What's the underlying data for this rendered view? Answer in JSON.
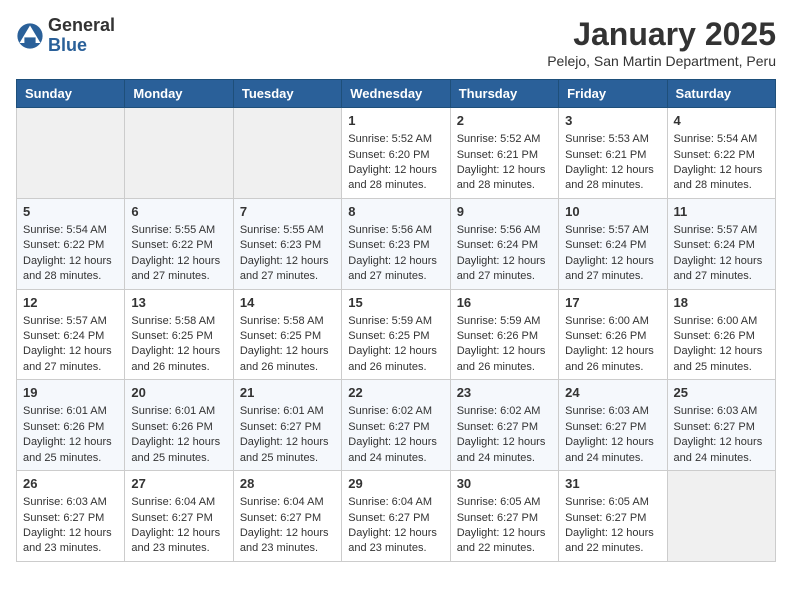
{
  "header": {
    "logo_general": "General",
    "logo_blue": "Blue",
    "month_title": "January 2025",
    "location": "Pelejo, San Martin Department, Peru"
  },
  "weekdays": [
    "Sunday",
    "Monday",
    "Tuesday",
    "Wednesday",
    "Thursday",
    "Friday",
    "Saturday"
  ],
  "weeks": [
    [
      {
        "day": "",
        "sunrise": "",
        "sunset": "",
        "daylight": ""
      },
      {
        "day": "",
        "sunrise": "",
        "sunset": "",
        "daylight": ""
      },
      {
        "day": "",
        "sunrise": "",
        "sunset": "",
        "daylight": ""
      },
      {
        "day": "1",
        "sunrise": "Sunrise: 5:52 AM",
        "sunset": "Sunset: 6:20 PM",
        "daylight": "Daylight: 12 hours and 28 minutes."
      },
      {
        "day": "2",
        "sunrise": "Sunrise: 5:52 AM",
        "sunset": "Sunset: 6:21 PM",
        "daylight": "Daylight: 12 hours and 28 minutes."
      },
      {
        "day": "3",
        "sunrise": "Sunrise: 5:53 AM",
        "sunset": "Sunset: 6:21 PM",
        "daylight": "Daylight: 12 hours and 28 minutes."
      },
      {
        "day": "4",
        "sunrise": "Sunrise: 5:54 AM",
        "sunset": "Sunset: 6:22 PM",
        "daylight": "Daylight: 12 hours and 28 minutes."
      }
    ],
    [
      {
        "day": "5",
        "sunrise": "Sunrise: 5:54 AM",
        "sunset": "Sunset: 6:22 PM",
        "daylight": "Daylight: 12 hours and 28 minutes."
      },
      {
        "day": "6",
        "sunrise": "Sunrise: 5:55 AM",
        "sunset": "Sunset: 6:22 PM",
        "daylight": "Daylight: 12 hours and 27 minutes."
      },
      {
        "day": "7",
        "sunrise": "Sunrise: 5:55 AM",
        "sunset": "Sunset: 6:23 PM",
        "daylight": "Daylight: 12 hours and 27 minutes."
      },
      {
        "day": "8",
        "sunrise": "Sunrise: 5:56 AM",
        "sunset": "Sunset: 6:23 PM",
        "daylight": "Daylight: 12 hours and 27 minutes."
      },
      {
        "day": "9",
        "sunrise": "Sunrise: 5:56 AM",
        "sunset": "Sunset: 6:24 PM",
        "daylight": "Daylight: 12 hours and 27 minutes."
      },
      {
        "day": "10",
        "sunrise": "Sunrise: 5:57 AM",
        "sunset": "Sunset: 6:24 PM",
        "daylight": "Daylight: 12 hours and 27 minutes."
      },
      {
        "day": "11",
        "sunrise": "Sunrise: 5:57 AM",
        "sunset": "Sunset: 6:24 PM",
        "daylight": "Daylight: 12 hours and 27 minutes."
      }
    ],
    [
      {
        "day": "12",
        "sunrise": "Sunrise: 5:57 AM",
        "sunset": "Sunset: 6:24 PM",
        "daylight": "Daylight: 12 hours and 27 minutes."
      },
      {
        "day": "13",
        "sunrise": "Sunrise: 5:58 AM",
        "sunset": "Sunset: 6:25 PM",
        "daylight": "Daylight: 12 hours and 26 minutes."
      },
      {
        "day": "14",
        "sunrise": "Sunrise: 5:58 AM",
        "sunset": "Sunset: 6:25 PM",
        "daylight": "Daylight: 12 hours and 26 minutes."
      },
      {
        "day": "15",
        "sunrise": "Sunrise: 5:59 AM",
        "sunset": "Sunset: 6:25 PM",
        "daylight": "Daylight: 12 hours and 26 minutes."
      },
      {
        "day": "16",
        "sunrise": "Sunrise: 5:59 AM",
        "sunset": "Sunset: 6:26 PM",
        "daylight": "Daylight: 12 hours and 26 minutes."
      },
      {
        "day": "17",
        "sunrise": "Sunrise: 6:00 AM",
        "sunset": "Sunset: 6:26 PM",
        "daylight": "Daylight: 12 hours and 26 minutes."
      },
      {
        "day": "18",
        "sunrise": "Sunrise: 6:00 AM",
        "sunset": "Sunset: 6:26 PM",
        "daylight": "Daylight: 12 hours and 25 minutes."
      }
    ],
    [
      {
        "day": "19",
        "sunrise": "Sunrise: 6:01 AM",
        "sunset": "Sunset: 6:26 PM",
        "daylight": "Daylight: 12 hours and 25 minutes."
      },
      {
        "day": "20",
        "sunrise": "Sunrise: 6:01 AM",
        "sunset": "Sunset: 6:26 PM",
        "daylight": "Daylight: 12 hours and 25 minutes."
      },
      {
        "day": "21",
        "sunrise": "Sunrise: 6:01 AM",
        "sunset": "Sunset: 6:27 PM",
        "daylight": "Daylight: 12 hours and 25 minutes."
      },
      {
        "day": "22",
        "sunrise": "Sunrise: 6:02 AM",
        "sunset": "Sunset: 6:27 PM",
        "daylight": "Daylight: 12 hours and 24 minutes."
      },
      {
        "day": "23",
        "sunrise": "Sunrise: 6:02 AM",
        "sunset": "Sunset: 6:27 PM",
        "daylight": "Daylight: 12 hours and 24 minutes."
      },
      {
        "day": "24",
        "sunrise": "Sunrise: 6:03 AM",
        "sunset": "Sunset: 6:27 PM",
        "daylight": "Daylight: 12 hours and 24 minutes."
      },
      {
        "day": "25",
        "sunrise": "Sunrise: 6:03 AM",
        "sunset": "Sunset: 6:27 PM",
        "daylight": "Daylight: 12 hours and 24 minutes."
      }
    ],
    [
      {
        "day": "26",
        "sunrise": "Sunrise: 6:03 AM",
        "sunset": "Sunset: 6:27 PM",
        "daylight": "Daylight: 12 hours and 23 minutes."
      },
      {
        "day": "27",
        "sunrise": "Sunrise: 6:04 AM",
        "sunset": "Sunset: 6:27 PM",
        "daylight": "Daylight: 12 hours and 23 minutes."
      },
      {
        "day": "28",
        "sunrise": "Sunrise: 6:04 AM",
        "sunset": "Sunset: 6:27 PM",
        "daylight": "Daylight: 12 hours and 23 minutes."
      },
      {
        "day": "29",
        "sunrise": "Sunrise: 6:04 AM",
        "sunset": "Sunset: 6:27 PM",
        "daylight": "Daylight: 12 hours and 23 minutes."
      },
      {
        "day": "30",
        "sunrise": "Sunrise: 6:05 AM",
        "sunset": "Sunset: 6:27 PM",
        "daylight": "Daylight: 12 hours and 22 minutes."
      },
      {
        "day": "31",
        "sunrise": "Sunrise: 6:05 AM",
        "sunset": "Sunset: 6:27 PM",
        "daylight": "Daylight: 12 hours and 22 minutes."
      },
      {
        "day": "",
        "sunrise": "",
        "sunset": "",
        "daylight": ""
      }
    ]
  ]
}
